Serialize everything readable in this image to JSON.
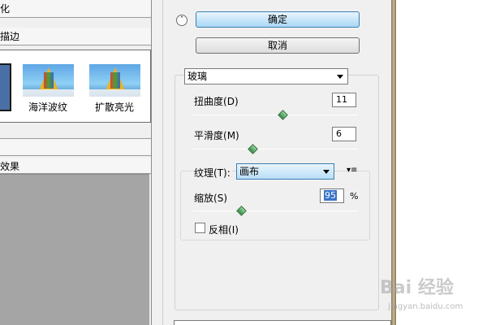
{
  "left_panel": {
    "top_label": "化",
    "category_label": "描边",
    "filters": [
      {
        "label": "海洋波纹"
      },
      {
        "label": "扩散亮光"
      }
    ],
    "effect_label": "效果"
  },
  "buttons": {
    "ok": "确定",
    "cancel": "取消"
  },
  "filter_select": "玻璃",
  "params": {
    "distortion": {
      "label": "扭曲度",
      "shortcut": "(D)",
      "value": "11",
      "level": 0.55
    },
    "smoothness": {
      "label": "平滑度",
      "shortcut": "(M)",
      "value": "6",
      "level": 0.37
    },
    "texture": {
      "label": "纹理",
      "shortcut": "(T):",
      "value": "画布"
    },
    "scale": {
      "label": "缩放",
      "shortcut": "(S)",
      "value": "95",
      "unit": "%",
      "level": 0.3
    },
    "invert": {
      "label": "反相",
      "shortcut": "(I)",
      "checked": false
    }
  },
  "watermark": {
    "text": "Bai 经验",
    "url": "jingyan.baidu.com"
  },
  "colors": {
    "accent": "#a9d7f5",
    "panel_bg": "#f0f0f0",
    "preview_bg": "#a5a5a5",
    "slider_knob": "#3a8b49"
  }
}
